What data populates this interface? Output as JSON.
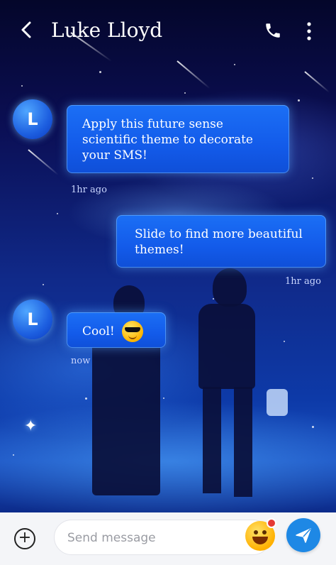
{
  "header": {
    "contact_name": "Luke Lloyd",
    "back_icon": "chevron-left-icon",
    "call_icon": "phone-icon",
    "menu_icon": "more-vertical-icon"
  },
  "messages": [
    {
      "direction": "incoming",
      "avatar_letter": "L",
      "text": "Apply this future sense scientific theme to decorate your SMS!",
      "time": "1hr ago"
    },
    {
      "direction": "outgoing",
      "text": "Slide to find more beautiful themes!",
      "time": "1hr ago"
    },
    {
      "direction": "incoming",
      "avatar_letter": "L",
      "text": "Cool!",
      "emoji": "smiling-face-with-sunglasses",
      "time": "now"
    }
  ],
  "composer": {
    "add_icon": "plus-circle-icon",
    "placeholder": "Send message",
    "value": "",
    "emoji_icon": "grinning-face-icon",
    "send_icon": "send-icon"
  },
  "colors": {
    "bubble": "#1464ef",
    "send_button": "#1e88e5",
    "composer_bg": "#f4f5f8"
  }
}
